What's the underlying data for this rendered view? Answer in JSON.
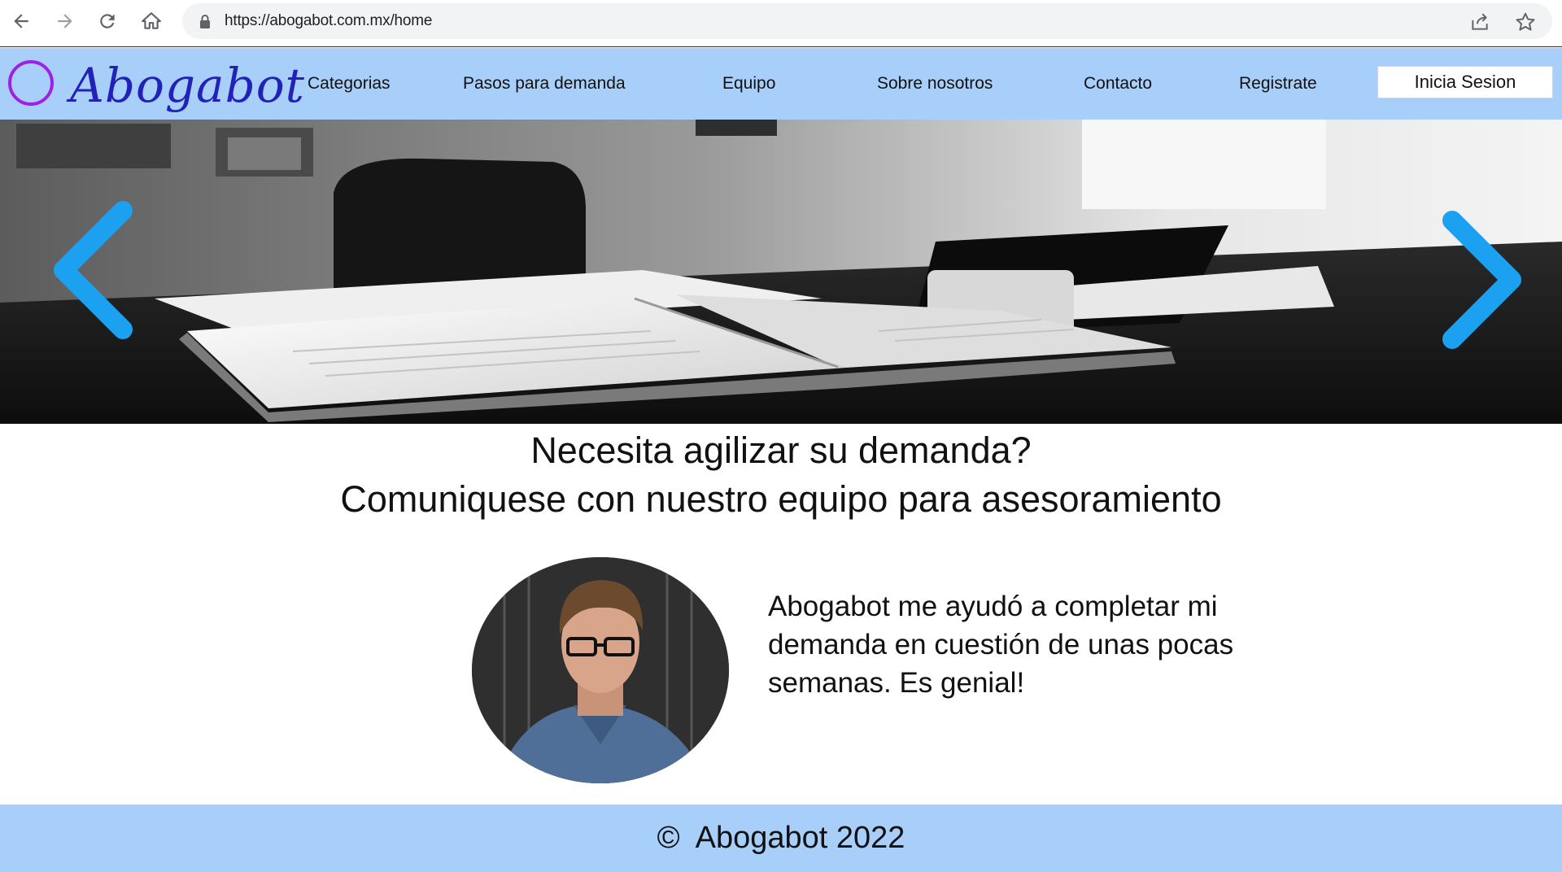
{
  "browser": {
    "url": "https://abogabot.com.mx/home",
    "icons": [
      "back-icon",
      "forward-icon",
      "reload-icon",
      "home-icon",
      "lock-icon",
      "share-icon",
      "star-icon"
    ]
  },
  "header": {
    "logo_text": "Abogabot",
    "nav": [
      {
        "label": "Categorias"
      },
      {
        "label": "Pasos para demanda"
      },
      {
        "label": "Equipo"
      },
      {
        "label": "Sobre nosotros"
      },
      {
        "label": "Contacto"
      },
      {
        "label": "Registrate"
      }
    ],
    "login_label": "Inicia Sesion"
  },
  "hero": {
    "prev_icon": "chevron-left-icon",
    "next_icon": "chevron-right-icon",
    "arrow_color": "#1ba1f0"
  },
  "main": {
    "headline_line1": "Necesita agilizar su demanda?",
    "headline_line2": "Comuniquese con nuestro equipo para asesoramiento",
    "testimonial": "Abogabot me ayudó a completar mi demanda en cuestión de unas pocas semanas.  Es genial!"
  },
  "footer": {
    "copyright": "©  Abogabot 2022"
  },
  "colors": {
    "header_bg": "#a7cffa",
    "footer_bg": "#a7cffa",
    "logo_text": "#2222b8",
    "logo_circle": "#a21ee8"
  }
}
